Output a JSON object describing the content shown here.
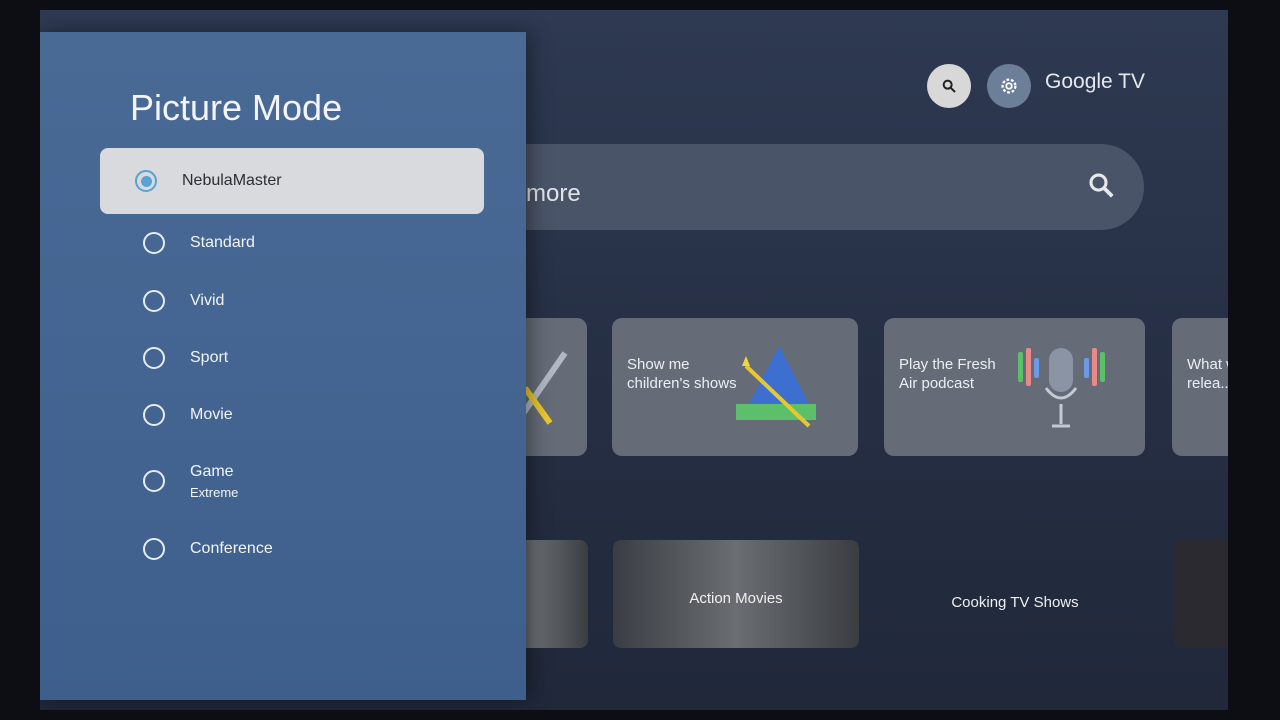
{
  "header": {
    "brand": "Google TV",
    "search_icon": "search-icon",
    "settings_icon": "gear-icon"
  },
  "searchbar": {
    "text": "more"
  },
  "suggestions": [
    {
      "label": ""
    },
    {
      "label": "Show me children's shows"
    },
    {
      "label": "Play the Fresh Air podcast"
    },
    {
      "label": "What was A... relea..."
    }
  ],
  "categories": [
    {
      "label": ""
    },
    {
      "label": "Action Movies"
    },
    {
      "label": "Cooking TV Shows"
    },
    {
      "label": ""
    }
  ],
  "panel": {
    "title": "Picture Mode",
    "options": [
      {
        "label": "NebulaMaster",
        "selected": true
      },
      {
        "label": "Standard"
      },
      {
        "label": "Vivid"
      },
      {
        "label": "Sport"
      },
      {
        "label": "Movie"
      },
      {
        "label": "Game",
        "sublabel": "Extreme"
      },
      {
        "label": "Conference"
      }
    ]
  },
  "colors": {
    "panel": "#4a6a96",
    "accent": "#5aa2cf",
    "selected_bg": "#d9dadd"
  }
}
